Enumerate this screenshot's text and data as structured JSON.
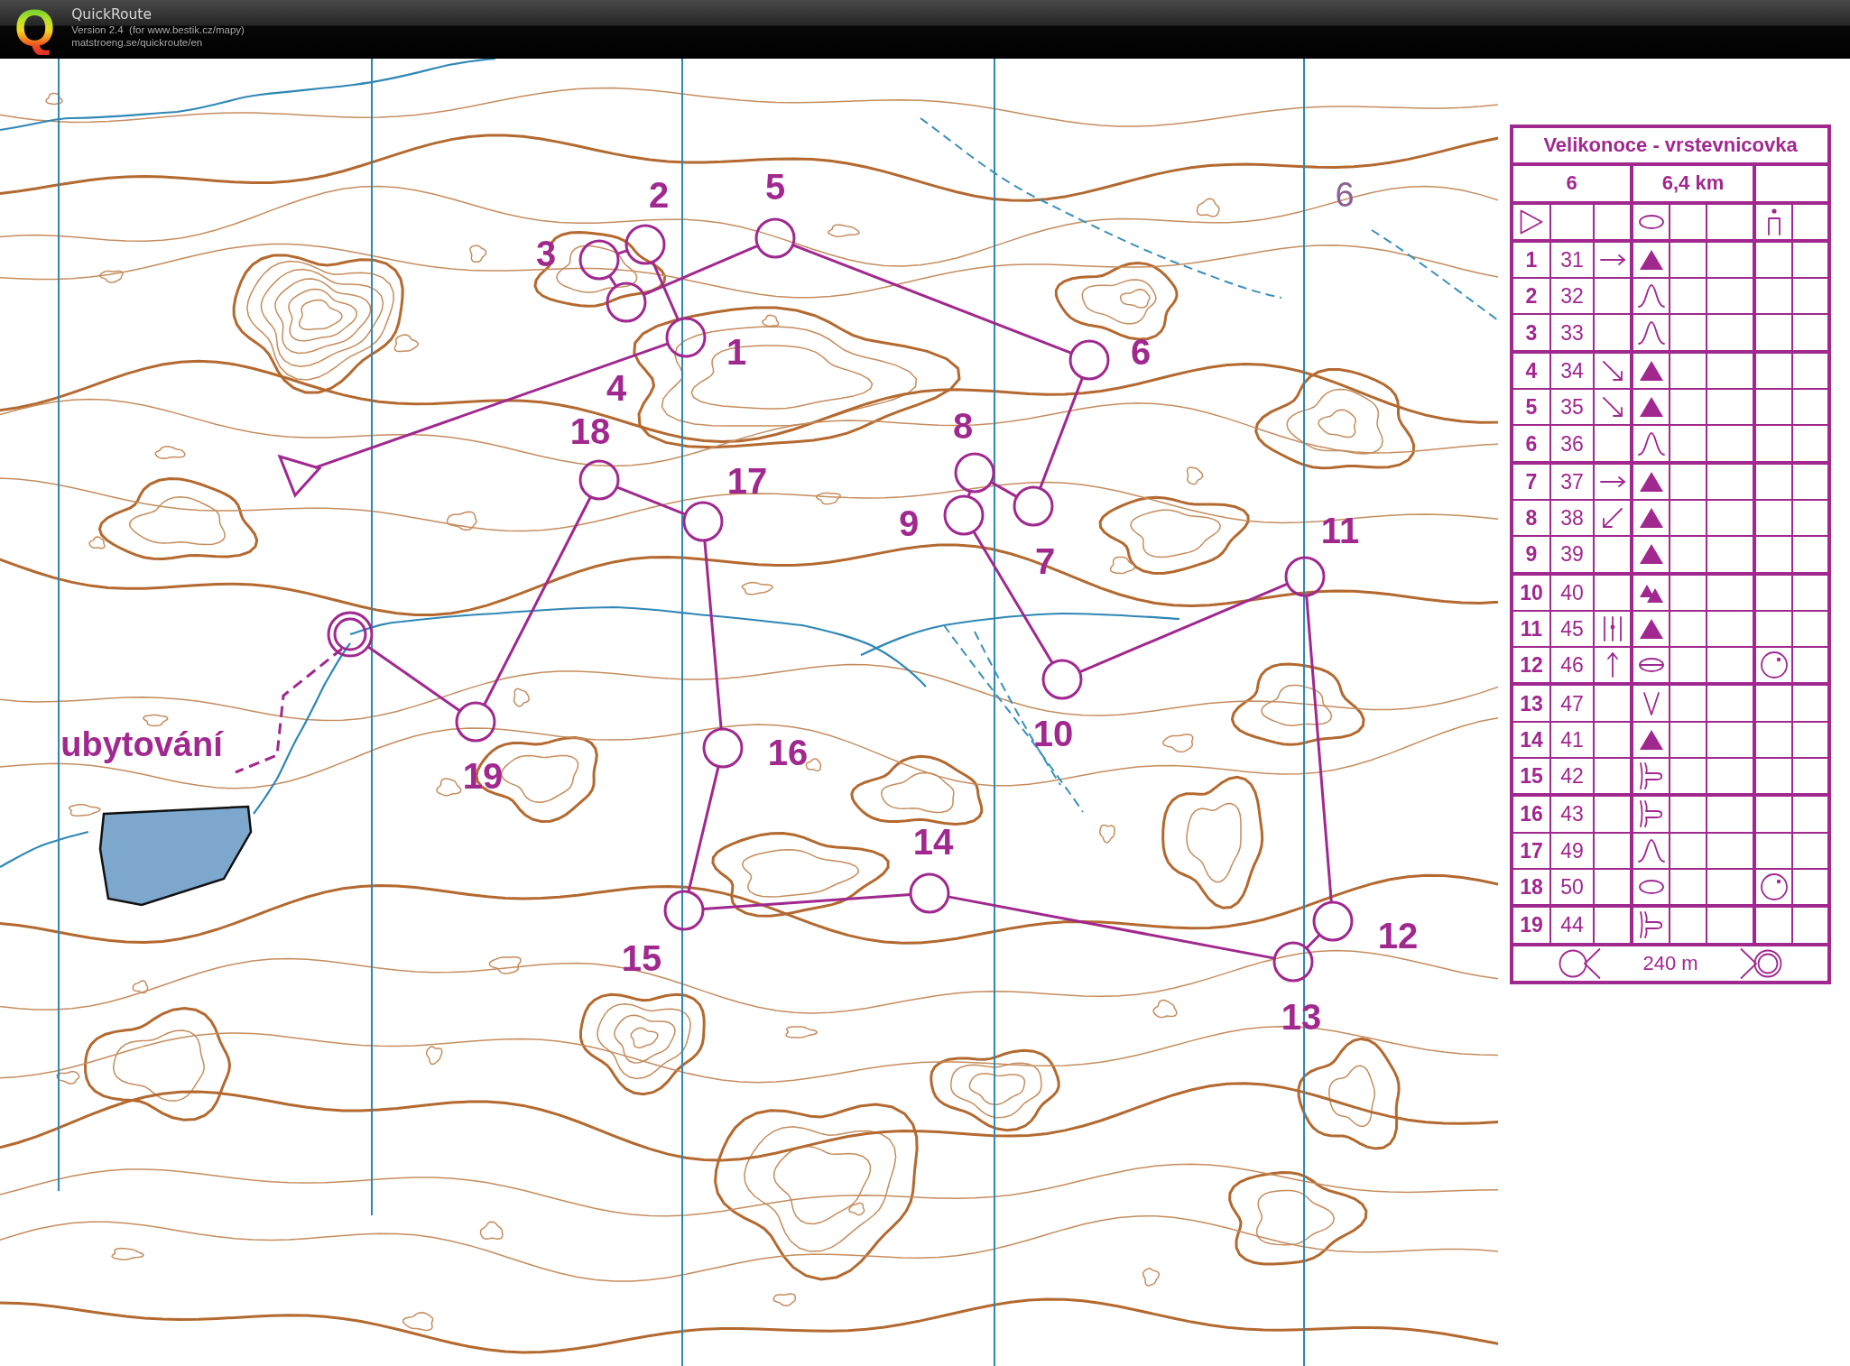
{
  "window": {
    "logo": "Q",
    "title": "QuickRoute",
    "version": "Version 2.4  (for www.bestik.cz/mapy)",
    "website": "matstroeng.se/quickroute/en"
  },
  "map": {
    "texts": [
      {
        "text": "6",
        "kind": "plain"
      },
      {
        "text": "ubytování",
        "kind": "place"
      }
    ],
    "course": {
      "controls": [
        {
          "number": "1"
        },
        {
          "number": "2"
        },
        {
          "number": "3"
        },
        {
          "number": "4"
        },
        {
          "number": "5"
        },
        {
          "number": "6"
        },
        {
          "number": "7"
        },
        {
          "number": "8"
        },
        {
          "number": "9"
        },
        {
          "number": "10"
        },
        {
          "number": "11"
        },
        {
          "number": "12"
        },
        {
          "number": "13"
        },
        {
          "number": "14"
        },
        {
          "number": "15"
        },
        {
          "number": "16"
        },
        {
          "number": "17"
        },
        {
          "number": "18"
        },
        {
          "number": "19"
        }
      ]
    }
  },
  "control_descriptions": {
    "title": "Velikonoce - vrstevnicovka",
    "course": "6",
    "length": "6,4 km",
    "start": {
      "feature": {
        "kind": "oval"
      },
      "location": {
        "kind": "dot-arch"
      }
    },
    "controls": [
      {
        "number": "1",
        "code": "31",
        "direction": {
          "kind": "arrow-e"
        },
        "feature": {
          "kind": "triangle"
        }
      },
      {
        "number": "2",
        "code": "32",
        "feature": {
          "kind": "bell"
        }
      },
      {
        "number": "3",
        "code": "33",
        "feature": {
          "kind": "bell"
        }
      },
      {
        "number": "4",
        "code": "34",
        "direction": {
          "kind": "arrow-se"
        },
        "feature": {
          "kind": "triangle"
        }
      },
      {
        "number": "5",
        "code": "35",
        "direction": {
          "kind": "arrow-se"
        },
        "feature": {
          "kind": "triangle"
        }
      },
      {
        "number": "6",
        "code": "36",
        "feature": {
          "kind": "bell"
        }
      },
      {
        "number": "7",
        "code": "37",
        "direction": {
          "kind": "arrow-e"
        },
        "feature": {
          "kind": "triangle"
        }
      },
      {
        "number": "8",
        "code": "38",
        "direction": {
          "kind": "arrow-sw"
        },
        "feature": {
          "kind": "triangle"
        }
      },
      {
        "number": "9",
        "code": "39",
        "feature": {
          "kind": "triangle"
        }
      },
      {
        "number": "10",
        "code": "40",
        "feature": {
          "kind": "two-triangles"
        }
      },
      {
        "number": "11",
        "code": "45",
        "direction": {
          "kind": "bars"
        },
        "feature": {
          "kind": "triangle"
        }
      },
      {
        "number": "12",
        "code": "46",
        "direction": {
          "kind": "arrow-n"
        },
        "feature": {
          "kind": "oval-bar"
        },
        "location": {
          "kind": "circle-dot"
        }
      },
      {
        "number": "13",
        "code": "47",
        "feature": {
          "kind": "v-shape"
        }
      },
      {
        "number": "14",
        "code": "41",
        "feature": {
          "kind": "triangle"
        }
      },
      {
        "number": "15",
        "code": "42",
        "feature": {
          "kind": "spur"
        }
      },
      {
        "number": "16",
        "code": "43",
        "feature": {
          "kind": "spur"
        }
      },
      {
        "number": "17",
        "code": "49",
        "feature": {
          "kind": "bell"
        }
      },
      {
        "number": "18",
        "code": "50",
        "feature": {
          "kind": "oval"
        },
        "location": {
          "kind": "circle-dot"
        }
      },
      {
        "number": "19",
        "code": "44",
        "feature": {
          "kind": "spur"
        }
      }
    ],
    "finish": {
      "distance": "240 m"
    }
  }
}
